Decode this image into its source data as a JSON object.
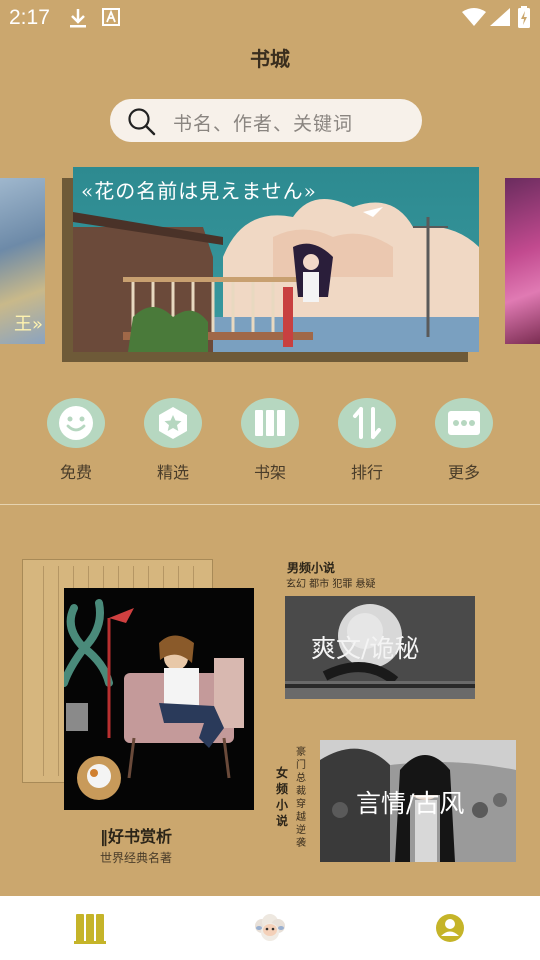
{
  "status_bar": {
    "time": "2:17"
  },
  "header": {
    "title": "书城"
  },
  "search": {
    "placeholder": "书名、作者、关键词"
  },
  "carousel": {
    "main_banner_title": "«花の名前は見えません»",
    "left_peek_text": "王»"
  },
  "quick_nav": [
    {
      "label": "免费",
      "icon": "smile-icon"
    },
    {
      "label": "精选",
      "icon": "star-badge-icon"
    },
    {
      "label": "书架",
      "icon": "bookshelf-icon"
    },
    {
      "label": "排行",
      "icon": "sort-icon"
    },
    {
      "label": "更多",
      "icon": "more-icon"
    }
  ],
  "featured": {
    "classic": {
      "title": "‖好书赏析",
      "subtitle": "世界经典名著"
    },
    "male": {
      "heading": "男频小说",
      "tags": "玄幻 都市 犯罪 悬疑",
      "panel_title": "爽文/诡秘"
    },
    "female": {
      "heading": "女频小说",
      "tags": "豪门总裁穿越逆袭",
      "panel_title": "言情/古风"
    }
  },
  "bottom_tabs": [
    {
      "name": "bookshelf",
      "icon": "books-icon"
    },
    {
      "name": "discover",
      "icon": "sheep-icon"
    },
    {
      "name": "profile",
      "icon": "user-icon"
    }
  ],
  "colors": {
    "background": "#cba76e",
    "accent_circle": "#b6d7c0",
    "tab_active": "#c5b429",
    "search_bg": "#f7f1ea"
  }
}
